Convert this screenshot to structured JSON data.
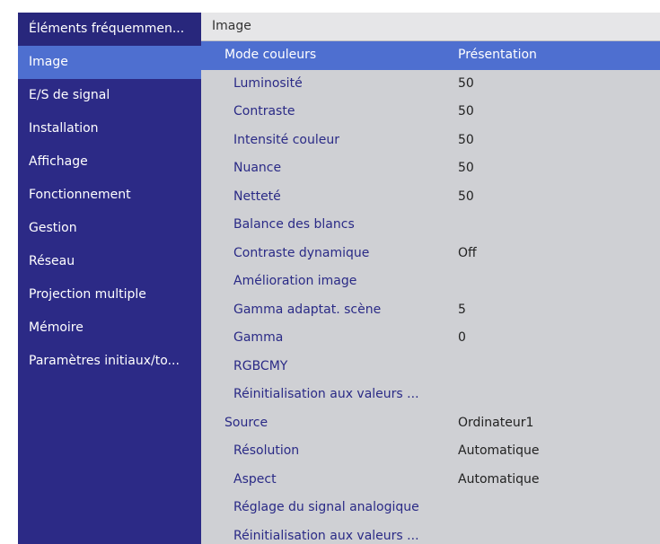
{
  "sidebar": {
    "items": [
      {
        "label": "Éléments fréquemmen..."
      },
      {
        "label": "Image"
      },
      {
        "label": "E/S de signal"
      },
      {
        "label": "Installation"
      },
      {
        "label": "Affichage"
      },
      {
        "label": "Fonctionnement"
      },
      {
        "label": "Gestion"
      },
      {
        "label": "Réseau"
      },
      {
        "label": "Projection multiple"
      },
      {
        "label": "Mémoire"
      },
      {
        "label": "Paramètres initiaux/to..."
      }
    ]
  },
  "panel": {
    "title": "Image",
    "rows": [
      {
        "label": "Mode couleurs",
        "value": "Présentation"
      },
      {
        "label": "Luminosité",
        "value": "50"
      },
      {
        "label": "Contraste",
        "value": "50"
      },
      {
        "label": "Intensité couleur",
        "value": "50"
      },
      {
        "label": "Nuance",
        "value": "50"
      },
      {
        "label": "Netteté",
        "value": "50"
      },
      {
        "label": "Balance des blancs",
        "value": ""
      },
      {
        "label": "Contraste dynamique",
        "value": "Off"
      },
      {
        "label": "Amélioration image",
        "value": ""
      },
      {
        "label": "Gamma adaptat. scène",
        "value": "5"
      },
      {
        "label": "Gamma",
        "value": "0"
      },
      {
        "label": "RGBCMY",
        "value": ""
      },
      {
        "label": "Réinitialisation aux valeurs ...",
        "value": ""
      },
      {
        "label": "Source",
        "value": "Ordinateur1"
      },
      {
        "label": "Résolution",
        "value": "Automatique"
      },
      {
        "label": "Aspect",
        "value": "Automatique"
      },
      {
        "label": "Réglage du signal analogique",
        "value": ""
      },
      {
        "label": "Réinitialisation aux valeurs ...",
        "value": ""
      }
    ]
  },
  "colors": {
    "sidebar_bg": "#2c2a86",
    "highlight": "#4e6fd0",
    "panel_bg": "#cfd0d4",
    "label_text": "#2a2a86"
  }
}
